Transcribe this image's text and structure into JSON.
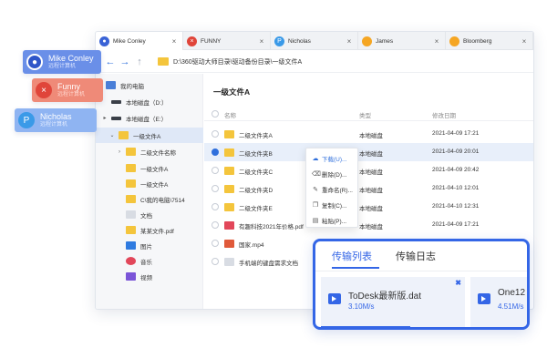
{
  "tabs": [
    {
      "label": "Mike Conley",
      "icon": "user-icon",
      "color": "#3a63d6"
    },
    {
      "label": "FUNNY",
      "icon": "x-icon",
      "color": "#e0453a"
    },
    {
      "label": "Nicholas",
      "icon": "p-icon",
      "color": "#3a9ae8"
    },
    {
      "label": "James",
      "icon": "orange-circle-icon",
      "color": "#f5a623"
    },
    {
      "label": "Bloomberg",
      "icon": "orange-circle-icon",
      "color": "#f5a623"
    }
  ],
  "address": {
    "path": "D:\\360驱动大师目录\\驱动备份目录\\一级文件A"
  },
  "sidebar": {
    "items": [
      {
        "label": "我的电脑",
        "icon": "pc-icon"
      },
      {
        "label": "本地磁盘（D:）",
        "icon": "drive-icon"
      },
      {
        "label": "本地磁盘（E:）",
        "icon": "drive-icon"
      },
      {
        "label": "一级文件A",
        "icon": "folder-icon"
      },
      {
        "label": "二级文件名称",
        "icon": "folder-icon"
      },
      {
        "label": "一级文件A",
        "icon": "folder-icon"
      },
      {
        "label": "一级文件A",
        "icon": "folder-icon"
      },
      {
        "label": "C\\我的电脑\\7514",
        "icon": "folder-icon"
      },
      {
        "label": "文档",
        "icon": "document-icon"
      },
      {
        "label": "某某文件.pdf",
        "icon": "folder-icon"
      },
      {
        "label": "图片",
        "icon": "picture-icon"
      },
      {
        "label": "音乐",
        "icon": "music-icon"
      },
      {
        "label": "视频",
        "icon": "video-icon"
      }
    ]
  },
  "content": {
    "title": "一级文件A",
    "columns": {
      "name": "名称",
      "type": "类型",
      "modified": "修改日期"
    },
    "rows": [
      {
        "name": "二级文件夹A",
        "type": "本地磁盘",
        "date": "2021-04-09  17:21",
        "icon": "folder-icon"
      },
      {
        "name": "二级文件夹B",
        "type": "本地磁盘",
        "date": "2021-04-09  20:01",
        "icon": "folder-icon"
      },
      {
        "name": "二级文件夹C",
        "type": "本地磁盘",
        "date": "2021-04-09  20:42",
        "icon": "folder-icon"
      },
      {
        "name": "二级文件夹D",
        "type": "本地磁盘",
        "date": "2021-04-10  12:01",
        "icon": "folder-icon"
      },
      {
        "name": "二级文件夹E",
        "type": "本地磁盘",
        "date": "2021-04-10  12:31",
        "icon": "folder-icon"
      },
      {
        "name": "有趣科技2021年价格.pdf",
        "type": "本地磁盘",
        "date": "2021-04-09  17:21",
        "icon": "pdf-icon"
      },
      {
        "name": "国家.mp4",
        "type": "",
        "date": "",
        "icon": "video-file-icon"
      },
      {
        "name": "手机端的键盘需求文档",
        "type": "",
        "date": "",
        "icon": "document-icon"
      }
    ]
  },
  "context_menu": {
    "items": [
      {
        "label": "下载(U)...",
        "icon": "download-icon"
      },
      {
        "label": "删除(D)...",
        "icon": "delete-icon"
      },
      {
        "label": "重命名(R)...",
        "icon": "rename-icon"
      },
      {
        "label": "复制(C)...",
        "icon": "copy-icon"
      },
      {
        "label": "粘贴(P)...",
        "icon": "paste-icon"
      }
    ]
  },
  "transfer": {
    "tabs": [
      "传输列表",
      "传输日志"
    ],
    "items": [
      {
        "name": "ToDesk最新版.dat",
        "speed": "3.10M/s",
        "progress": 0.62
      },
      {
        "name": "One12",
        "speed": "4.51M/s",
        "progress": 0.0
      }
    ]
  },
  "user_cards": [
    {
      "name": "Mike Conley",
      "sub": "远程计算机",
      "color": "#6a8fe8",
      "icon": "user-icon"
    },
    {
      "name": "Funny",
      "sub": "远程计算机",
      "color": "#ef8a78",
      "icon": "x-icon"
    },
    {
      "name": "Nicholas",
      "sub": "远程计算机",
      "color": "#8fb4f2",
      "icon": "p-icon"
    }
  ],
  "colors": {
    "accent": "#3466e6",
    "folder": "#f4c53c",
    "selection": "#e8effa"
  }
}
